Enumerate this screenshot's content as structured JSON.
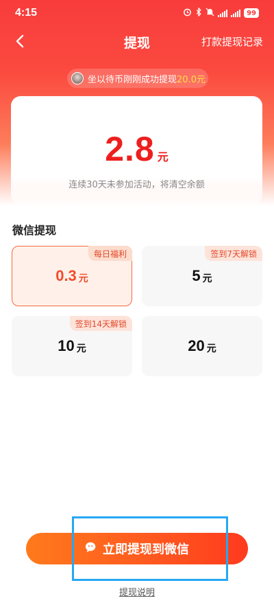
{
  "status_bar": {
    "time": "4:15",
    "battery": "99",
    "icons": [
      "alarm-icon",
      "bluetooth-icon",
      "mute-icon",
      "signal-icon",
      "signal-icon",
      "battery-icon"
    ]
  },
  "nav": {
    "title": "提现",
    "record_link": "打款提现记录",
    "back_icon": "chevron-left-icon"
  },
  "notice": {
    "text": "坐以待币刚刚成功提现",
    "amount": "20.0元"
  },
  "balance": {
    "value": "2.8",
    "unit": "元",
    "tip": "连续30天未参加活动，将清空余额"
  },
  "section": {
    "title": "微信提现"
  },
  "options": [
    {
      "amount": "0.3",
      "unit": "元",
      "badge": "每日福利",
      "selected": true
    },
    {
      "amount": "5",
      "unit": "元",
      "badge": "签到7天解锁",
      "selected": false
    },
    {
      "amount": "10",
      "unit": "元",
      "badge": "签到14天解锁",
      "selected": false
    },
    {
      "amount": "20",
      "unit": "元",
      "badge": "",
      "selected": false
    }
  ],
  "cta": {
    "label": "立即提现到微信",
    "icon": "wechat-icon"
  },
  "explain": {
    "label": "提现说明"
  },
  "colors": {
    "brand_red": "#f83c3c",
    "amount_red": "#ee1f1f",
    "cta_orange": "#ff5a1f",
    "badge_text": "#e24a2a",
    "focus_blue": "#25a8f4"
  }
}
